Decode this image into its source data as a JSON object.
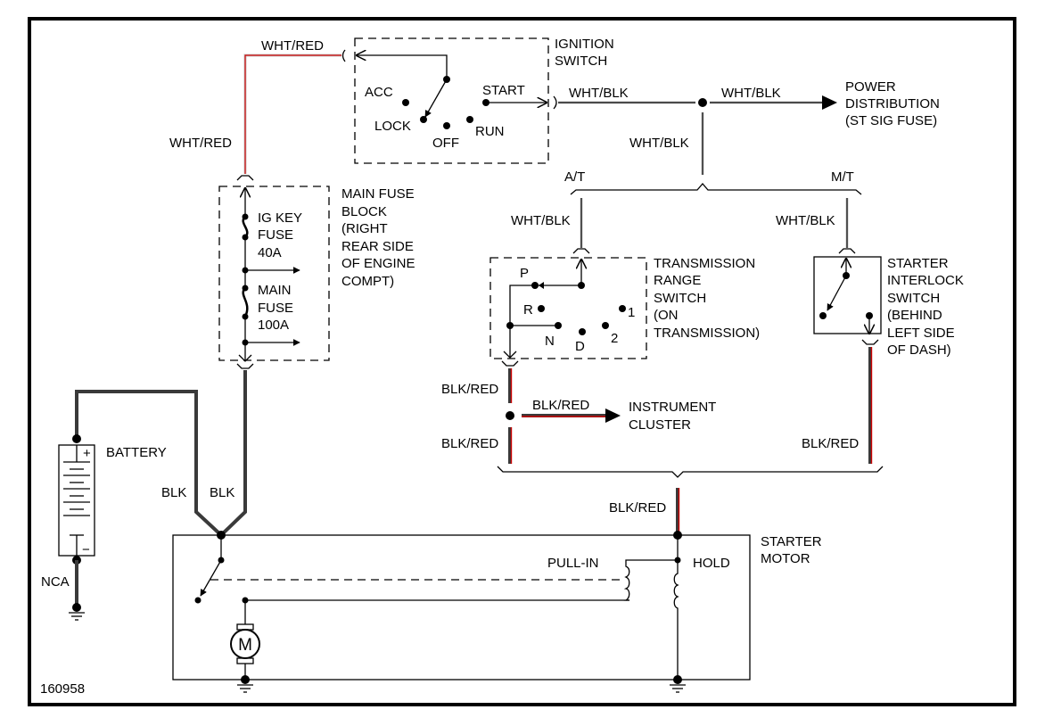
{
  "diagram_id": "160958",
  "colors": {
    "wire_white": "#c8c8c8",
    "wire_black": "#3a3a3a",
    "tracer_red": "#cc0000"
  },
  "components": {
    "ignition_switch": {
      "title_lines": [
        "IGNITION",
        "SWITCH"
      ],
      "positions": {
        "acc": "ACC",
        "lock": "LOCK",
        "off": "OFF",
        "run": "RUN",
        "start": "START"
      }
    },
    "power_distribution": {
      "lines": [
        "POWER",
        "DISTRIBUTION",
        "(ST SIG FUSE)"
      ]
    },
    "main_fuse_block": {
      "title_lines": [
        "MAIN FUSE",
        "BLOCK",
        "(RIGHT",
        "REAR SIDE",
        "OF ENGINE",
        "COMPT)"
      ],
      "fuses": [
        {
          "lines": [
            "IG KEY",
            "FUSE",
            "40A"
          ]
        },
        {
          "lines": [
            "MAIN",
            "FUSE",
            "100A"
          ]
        }
      ]
    },
    "transmission_range_switch": {
      "title_lines": [
        "TRANSMISSION",
        "RANGE",
        "SWITCH",
        "(ON",
        "TRANSMISSION)"
      ],
      "positions": {
        "p": "P",
        "r": "R",
        "n": "N",
        "d": "D",
        "two": "2",
        "one": "1"
      }
    },
    "starter_interlock_switch": {
      "title_lines": [
        "STARTER",
        "INTERLOCK",
        "SWITCH",
        "(BEHIND",
        "LEFT SIDE",
        "OF DASH)"
      ]
    },
    "instrument_cluster": {
      "lines": [
        "INSTRUMENT",
        "CLUSTER"
      ]
    },
    "battery": {
      "label": "BATTERY",
      "plus": "+",
      "minus": "−",
      "ground_label": "NCA"
    },
    "starter_motor": {
      "title_lines": [
        "STARTER",
        "MOTOR"
      ],
      "pull_in": "PULL-IN",
      "hold": "HOLD",
      "motor_symbol": "M"
    }
  },
  "branches": {
    "at": "A/T",
    "mt": "M/T"
  },
  "wires": {
    "wht_red_top": "WHT/RED",
    "wht_red_left": "WHT/RED",
    "wht_blk_1": "WHT/BLK",
    "wht_blk_2": "WHT/BLK",
    "wht_blk_down": "WHT/BLK",
    "wht_blk_at": "WHT/BLK",
    "wht_blk_mt": "WHT/BLK",
    "blk_red_1": "BLK/RED",
    "blk_red_ic": "BLK/RED",
    "blk_red_2": "BLK/RED",
    "blk_red_mt": "BLK/RED",
    "blk_red_starter": "BLK/RED",
    "blk_1": "BLK",
    "blk_2": "BLK"
  }
}
